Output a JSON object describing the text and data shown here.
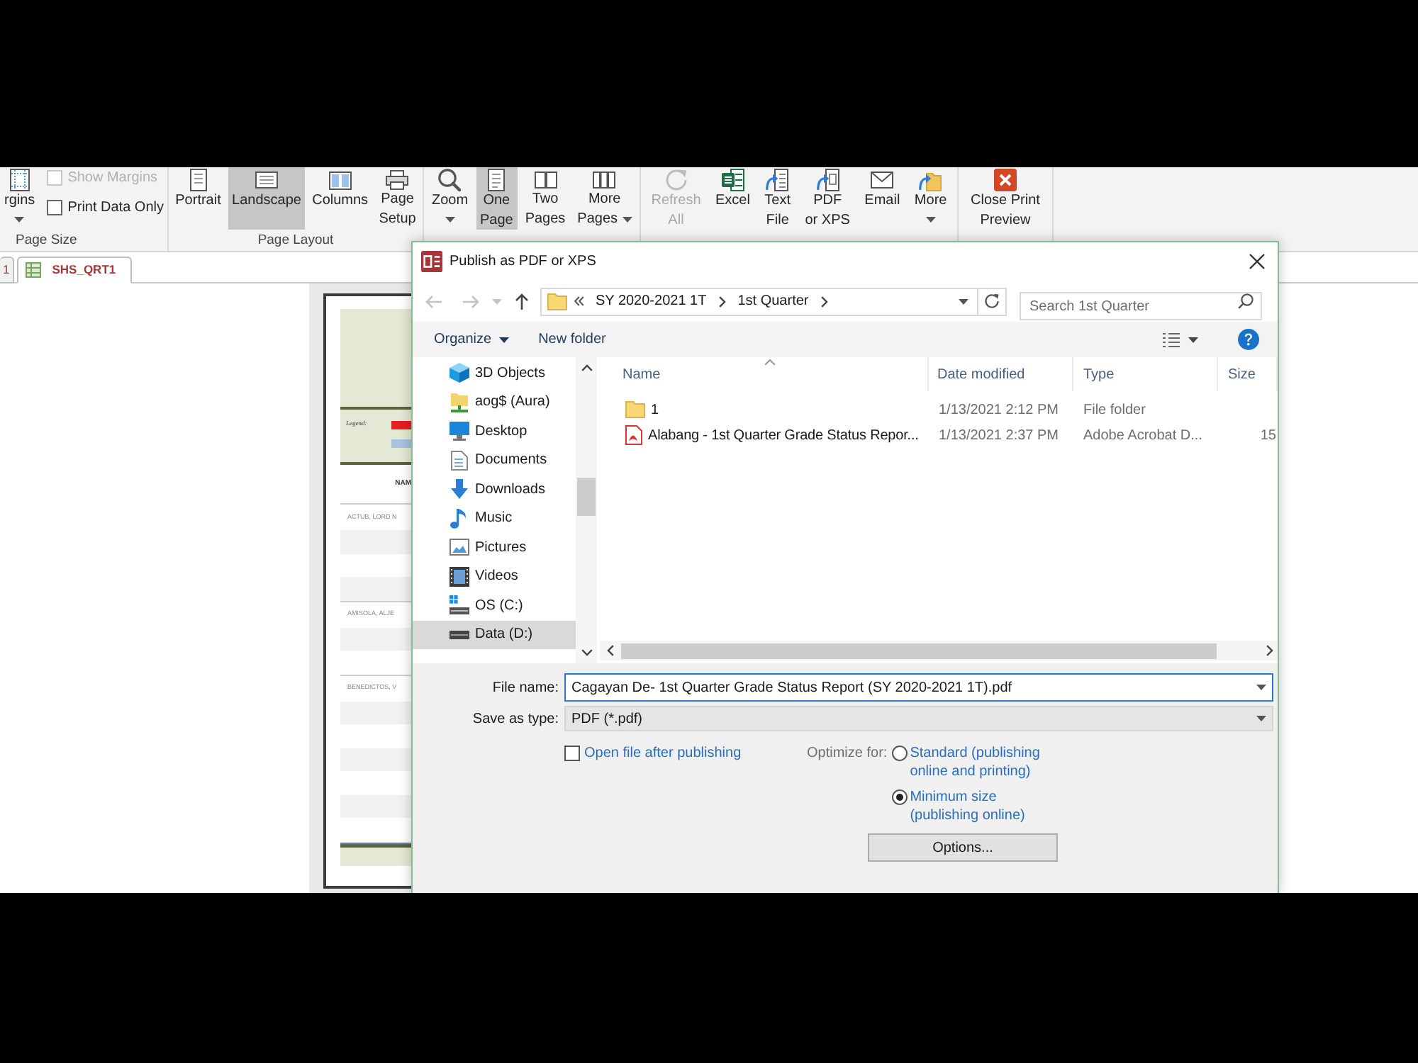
{
  "ribbon": {
    "groups": [
      {
        "label": "Page Size",
        "items": [
          {
            "kind": "button",
            "lines": [
              "rgins"
            ],
            "selected": false,
            "disabled": false,
            "dropdown": true
          },
          {
            "kind": "checkbox",
            "label": "Show Margins",
            "checked": false,
            "disabled": true
          },
          {
            "kind": "checkbox",
            "label": "Print Data Only",
            "checked": false,
            "disabled": false
          }
        ]
      },
      {
        "label": "Page Layout",
        "items": [
          {
            "kind": "button",
            "lines": [
              "Portrait"
            ],
            "selected": false,
            "disabled": false,
            "dropdown": false
          },
          {
            "kind": "button",
            "lines": [
              "Landscape"
            ],
            "selected": true,
            "disabled": false,
            "dropdown": false
          },
          {
            "kind": "button",
            "lines": [
              "Columns"
            ],
            "selected": false,
            "disabled": false,
            "dropdown": false
          },
          {
            "kind": "button",
            "lines": [
              "Page",
              "Setup"
            ],
            "selected": false,
            "disabled": false,
            "dropdown": false
          }
        ]
      },
      {
        "items": [
          {
            "kind": "button",
            "lines": [
              "Zoom"
            ],
            "selected": false,
            "disabled": false,
            "dropdown": true
          },
          {
            "kind": "button",
            "lines": [
              "One",
              "Page"
            ],
            "selected": true,
            "disabled": false,
            "dropdown": false
          },
          {
            "kind": "button",
            "lines": [
              "Two",
              "Pages"
            ],
            "selected": false,
            "disabled": false,
            "dropdown": false
          },
          {
            "kind": "button",
            "lines": [
              "More",
              "Pages"
            ],
            "selected": false,
            "disabled": false,
            "dropdown": true
          }
        ]
      },
      {
        "items": [
          {
            "kind": "button",
            "lines": [
              "Refresh",
              "All"
            ],
            "selected": false,
            "disabled": true,
            "dropdown": false
          },
          {
            "kind": "button",
            "lines": [
              "Excel"
            ],
            "selected": false,
            "disabled": false,
            "dropdown": false
          },
          {
            "kind": "button",
            "lines": [
              "Text",
              "File"
            ],
            "selected": false,
            "disabled": false,
            "dropdown": false
          },
          {
            "kind": "button",
            "lines": [
              "PDF",
              "or XPS"
            ],
            "selected": false,
            "disabled": false,
            "dropdown": false
          },
          {
            "kind": "button",
            "lines": [
              "Email"
            ],
            "selected": false,
            "disabled": false,
            "dropdown": false
          },
          {
            "kind": "button",
            "lines": [
              "More"
            ],
            "selected": false,
            "disabled": false,
            "dropdown": true
          }
        ]
      },
      {
        "items": [
          {
            "kind": "button",
            "lines": [
              "Close Print",
              "Preview"
            ],
            "selected": false,
            "disabled": false,
            "dropdown": false
          }
        ]
      }
    ]
  },
  "object_tabs": [
    {
      "label": "1",
      "selected": false
    },
    {
      "label": "SHS_QRT1",
      "selected": true
    }
  ],
  "report_preview": {
    "legend": {
      "label": "Legend:",
      "swatches": [
        {
          "color": "#e31e24"
        },
        {
          "color": "#a8c2df"
        }
      ]
    },
    "column_header": "NAM",
    "students": [
      "ACTUB, LORD N",
      "AMISOLA, ALJE",
      "BENEDICTOS, V"
    ]
  },
  "dialog": {
    "title": "Publish as PDF or XPS",
    "nav_buttons": [
      {
        "kind": "back",
        "disabled": true
      },
      {
        "kind": "forward",
        "disabled": true
      },
      {
        "kind": "dropdown",
        "disabled": true
      },
      {
        "kind": "up",
        "disabled": false
      }
    ],
    "address_bar": {
      "path": [
        "SY 2020-2021 1T",
        "1st Quarter"
      ]
    },
    "search": {
      "placeholder": "Search 1st Quarter"
    },
    "toolbar": {
      "organize": "Organize",
      "new_folder": "New folder"
    },
    "nav_pane": {
      "items": [
        {
          "label": "3D Objects",
          "selected": false
        },
        {
          "label": "aog$ (Aura)",
          "selected": false
        },
        {
          "label": "Desktop",
          "selected": false
        },
        {
          "label": "Documents",
          "selected": false
        },
        {
          "label": "Downloads",
          "selected": false
        },
        {
          "label": "Music",
          "selected": false
        },
        {
          "label": "Pictures",
          "selected": false
        },
        {
          "label": "Videos",
          "selected": false
        },
        {
          "label": "OS (C:)",
          "selected": false
        },
        {
          "label": "Data (D:)",
          "selected": true
        }
      ]
    },
    "file_list": {
      "columns": [
        {
          "label": "Name",
          "sorted": true
        },
        {
          "label": "Date modified",
          "sorted": false
        },
        {
          "label": "Type",
          "sorted": false
        },
        {
          "label": "Size",
          "sorted": false
        }
      ],
      "rows": [
        {
          "kind": "folder",
          "name": "1",
          "date_modified": "1/13/2021 2:12 PM",
          "type": "File folder"
        },
        {
          "kind": "document",
          "name": "Alabang - 1st Quarter Grade Status Repor...",
          "date_modified": "1/13/2021 2:37 PM",
          "type": "Adobe Acrobat D...",
          "size": "15"
        }
      ]
    },
    "file_name": {
      "label": "File name:",
      "value": "Cagayan De- 1st Quarter Grade Status Report (SY 2020-2021 1T).pdf"
    },
    "save_as_type": {
      "label": "Save as type:",
      "value": "PDF (*.pdf)"
    },
    "open_after": {
      "label": "Open file after publishing",
      "checked": false
    },
    "optimize": {
      "label": "Optimize for:",
      "options": [
        {
          "lines": [
            "Standard (publishing",
            "online and printing)"
          ],
          "selected": false
        },
        {
          "lines": [
            "Minimum size",
            "(publishing online)"
          ],
          "selected": true
        }
      ]
    },
    "options_button": "Options..."
  }
}
